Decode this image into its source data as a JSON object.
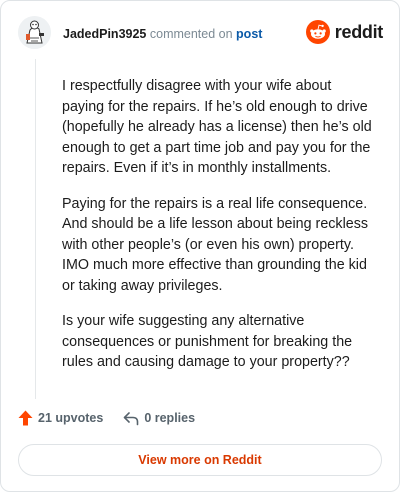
{
  "comment": {
    "username": "JadedPin3925",
    "action_text": "commented on",
    "target_link": "post",
    "paragraphs": [
      "I respectfully disagree with your wife about paying for the repairs. If he’s old enough to drive (hopefully he already has a license) then he’s old enough to get a part time job and pay you for the repairs. Even if it’s in monthly installments.",
      "Paying for the repairs is a real life consequence. And should be a life lesson about being reckless with other people’s (or even his own) property. IMO much more effective than grounding the kid or taking away privileges.",
      "Is your wife suggesting any alternative consequences or punishment for breaking the rules and causing damage to your property??"
    ]
  },
  "brand": {
    "wordmark": "reddit",
    "icon": "reddit-snoo-icon",
    "color": "#ff4500"
  },
  "actions": {
    "upvotes_label": "21 upvotes",
    "upvote_icon": "upvote-arrow-icon",
    "replies_label": "0 replies",
    "reply_icon": "reply-arrow-icon"
  },
  "footer": {
    "view_more_label": "View more on Reddit"
  },
  "colors": {
    "accent": "#d93900",
    "link": "#0b5aa8"
  }
}
